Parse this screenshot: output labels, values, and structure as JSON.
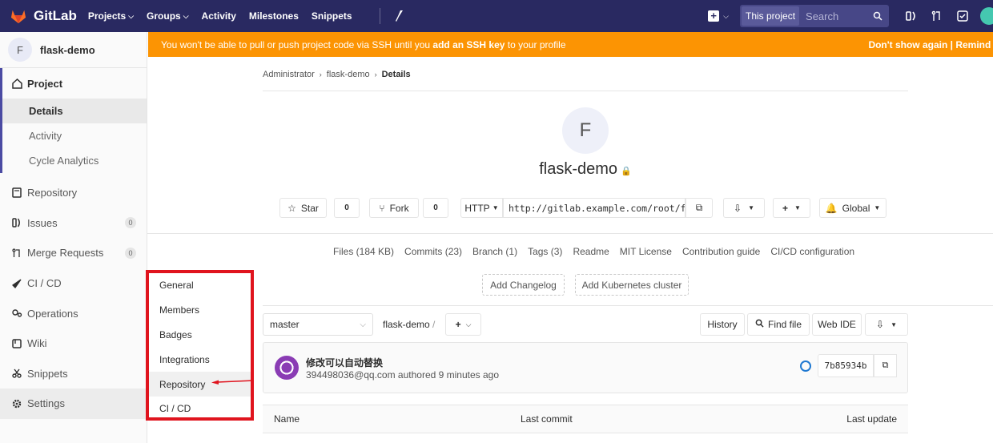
{
  "topbar": {
    "brand": "GitLab",
    "nav": [
      {
        "label": "Projects",
        "caret": true
      },
      {
        "label": "Groups",
        "caret": true
      },
      {
        "label": "Activity",
        "caret": false
      },
      {
        "label": "Milestones",
        "caret": false
      },
      {
        "label": "Snippets",
        "caret": false
      }
    ],
    "search_scope": "This project",
    "search_placeholder": "Search",
    "colors": {
      "bar": "#292961",
      "brand_orange": "#e24329"
    }
  },
  "sidebar": {
    "project_initial": "F",
    "project_name": "flask-demo",
    "project_label": "Project",
    "project_sub": [
      "Details",
      "Activity",
      "Cycle Analytics"
    ],
    "items": [
      {
        "label": "Repository",
        "icon": "repository-icon"
      },
      {
        "label": "Issues",
        "icon": "issues-icon",
        "badge": "0"
      },
      {
        "label": "Merge Requests",
        "icon": "merge-request-icon",
        "badge": "0"
      },
      {
        "label": "CI / CD",
        "icon": "rocket-icon"
      },
      {
        "label": "Operations",
        "icon": "operations-icon"
      },
      {
        "label": "Wiki",
        "icon": "book-icon"
      },
      {
        "label": "Snippets",
        "icon": "scissors-icon"
      },
      {
        "label": "Settings",
        "icon": "gear-icon"
      }
    ]
  },
  "banner": {
    "text_before": "You won't be able to pull or push project code via SSH until you ",
    "link": "add an SSH key",
    "text_after": " to your profile",
    "right": "Don't show again | Remind l"
  },
  "breadcrumb": [
    "Administrator",
    "flask-demo",
    "Details"
  ],
  "project": {
    "initial": "F",
    "title": "flask-demo",
    "star_label": "Star",
    "star_count": "0",
    "fork_label": "Fork",
    "fork_count": "0",
    "protocol": "HTTP",
    "clone_url": "http://gitlab.example.com/root/fl",
    "notification": "Global"
  },
  "stats": [
    "Files (184 KB)",
    "Commits (23)",
    "Branch (1)",
    "Tags (3)",
    "Readme",
    "MIT License",
    "Contribution guide",
    "CI/CD configuration"
  ],
  "actions": {
    "changelog": "Add Changelog",
    "kubernetes": "Add Kubernetes cluster"
  },
  "repo": {
    "branch": "master",
    "path": "flask-demo",
    "path_sep": "/",
    "history": "History",
    "find_file": "Find file",
    "web_ide": "Web IDE"
  },
  "commit": {
    "title": "修改可以自动替换",
    "meta": "394498036@qq.com authored 9 minutes ago",
    "sha": "7b85934b"
  },
  "table": {
    "name": "Name",
    "last_commit": "Last commit",
    "last_update": "Last update"
  },
  "settings_menu": [
    "General",
    "Members",
    "Badges",
    "Integrations",
    "Repository",
    "CI / CD"
  ]
}
